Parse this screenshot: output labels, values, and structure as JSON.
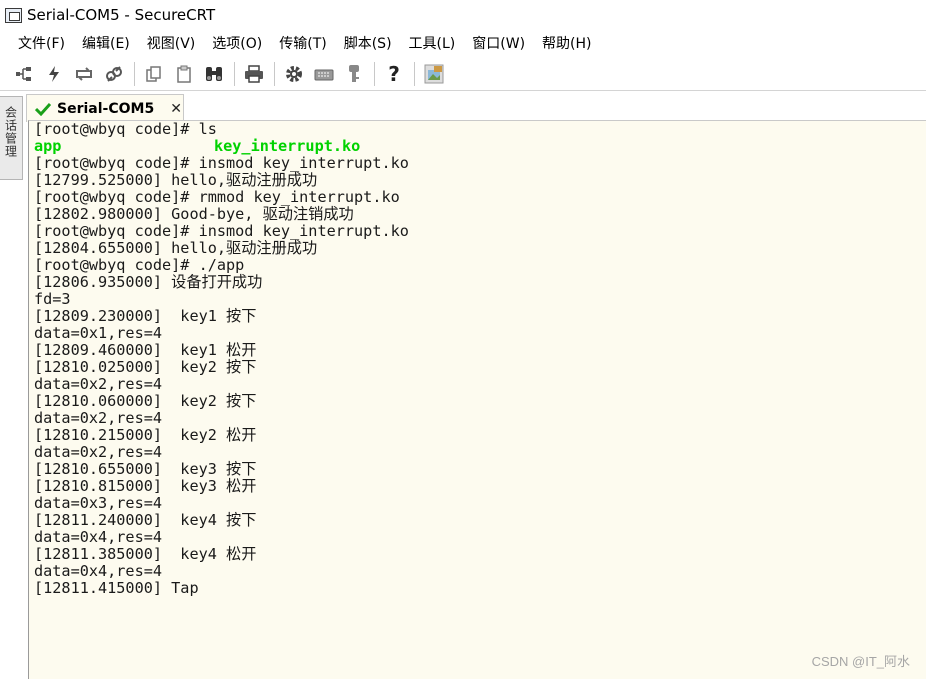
{
  "window": {
    "title": "Serial-COM5 - SecureCRT"
  },
  "menu": [
    "文件(F)",
    "编辑(E)",
    "视图(V)",
    "选项(O)",
    "传输(T)",
    "脚本(S)",
    "工具(L)",
    "窗口(W)",
    "帮助(H)"
  ],
  "toolbar": {
    "icons": [
      "connect-bar-icon",
      "quick-connect-icon",
      "reconnect-icon",
      "disconnect-icon",
      "copy-icon",
      "paste-icon",
      "find-icon",
      "print-icon",
      "settings-icon",
      "keymap-icon",
      "key-icon",
      "help-icon",
      "sftp-icon"
    ]
  },
  "sidebar": {
    "label": "会话管理"
  },
  "tab": {
    "label": "Serial-COM5",
    "close": "✕",
    "status_color": "#1aa01a"
  },
  "terminal": {
    "ls_cmd": "[root@wbyq code]# ls",
    "ls_app": "app",
    "ls_ko": "key_interrupt.ko",
    "lines": [
      "[root@wbyq code]# insmod key_interrupt.ko",
      "[12799.525000] hello,驱动注册成功",
      "[root@wbyq code]# rmmod key_interrupt.ko",
      "[12802.980000] Good-bye, 驱动注销成功",
      "[root@wbyq code]# insmod key_interrupt.ko",
      "[12804.655000] hello,驱动注册成功",
      "[root@wbyq code]# ./app",
      "[12806.935000] 设备打开成功",
      "fd=3",
      "[12809.230000]  key1 按下",
      "data=0x1,res=4",
      "[12809.460000]  key1 松开",
      "[12810.025000]  key2 按下",
      "data=0x2,res=4",
      "[12810.060000]  key2 按下",
      "data=0x2,res=4",
      "[12810.215000]  key2 松开",
      "data=0x2,res=4",
      "[12810.655000]  key3 按下",
      "[12810.815000]  key3 松开",
      "data=0x3,res=4",
      "[12811.240000]  key4 按下",
      "data=0x4,res=4",
      "[12811.385000]  key4 松开",
      "data=0x4,res=4",
      "[12811.415000] Tap"
    ]
  },
  "watermark": "CSDN @IT_阿水"
}
